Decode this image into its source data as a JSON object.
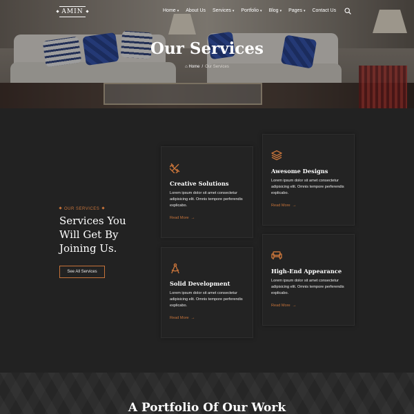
{
  "header": {
    "logo_text": "AMIN",
    "menu": [
      {
        "label": "Home",
        "has_dropdown": true
      },
      {
        "label": "About Us",
        "has_dropdown": false
      },
      {
        "label": "Services",
        "has_dropdown": true
      },
      {
        "label": "Portfolio",
        "has_dropdown": true
      },
      {
        "label": "Blog",
        "has_dropdown": true
      },
      {
        "label": "Pages",
        "has_dropdown": true
      },
      {
        "label": "Contact Us",
        "has_dropdown": false
      }
    ],
    "search_icon": "search-icon"
  },
  "hero": {
    "title": "Our Services",
    "breadcrumb": {
      "home": "Home",
      "separator": "/",
      "current": "Our Services"
    }
  },
  "intro": {
    "tag": "OUR SERVICES",
    "heading": "Services You Will Get By Joining Us.",
    "button_label": "See All Services"
  },
  "services": [
    {
      "icon": "pencil-ruler-icon",
      "title": "Creative Solutions",
      "description": "Lorem ipsum dolor sit amet consectetur adipisicing elit. Omnis tempore perferendis explicabo.",
      "link": "Read More"
    },
    {
      "icon": "layers-icon",
      "title": "Awesome Designs",
      "description": "Lorem ipsum dolor sit amet consectetur adipisicing elit. Omnis tempore perferendis explicabo.",
      "link": "Read More"
    },
    {
      "icon": "compass-icon",
      "title": "Solid Development",
      "description": "Lorem ipsum dolor sit amet consectetur adipisicing elit. Omnis tempore perferendis explicabo.",
      "link": "Read More"
    },
    {
      "icon": "sofa-icon",
      "title": "High-End Appearance",
      "description": "Lorem ipsum dolor sit amet consectetur adipisicing elit. Omnis tempore perferendis explicabo.",
      "link": "Read More"
    }
  ],
  "portfolio": {
    "title": "A Portfolio Of Our Work"
  },
  "colors": {
    "accent": "#c8743a",
    "background": "#222222",
    "card": "#232323"
  }
}
